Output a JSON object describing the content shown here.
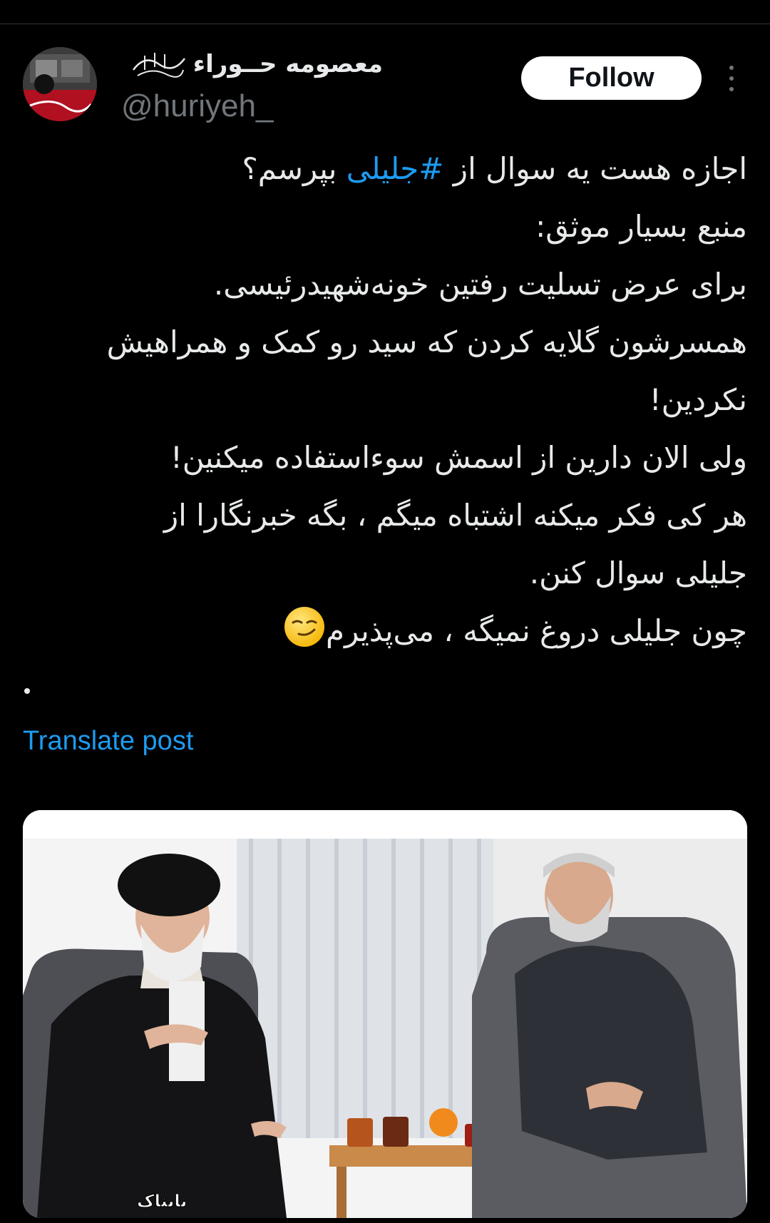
{
  "author": {
    "display_name": "معصومه حــوراء",
    "handle": "@huriyeh_",
    "avatar_icon": "profile-avatar"
  },
  "actions": {
    "follow_label": "Follow",
    "more_icon": "more-vertical-icon"
  },
  "tweet": {
    "lines": [
      {
        "before": "اجازه هست یه سوال از ",
        "hashtag": "#جلیلی",
        "after": " بپرسم؟"
      },
      {
        "text": "منبع بسیار موثق:"
      },
      {
        "text": "برای عرض تسلیت رفتین خونه‌شهیدرئیسی."
      },
      {
        "text": "همسرشون گلایه کردن که سید رو کمک و همراهیش"
      },
      {
        "text": "نکردین!"
      },
      {
        "text": "ولی الان دارین از اسمش سوءاستفاده میکنین!"
      },
      {
        "text": "هر کی فکر میکنه اشتباه میگم ، بگه خبرنگارا از"
      },
      {
        "text": "جلیلی سوال کنن."
      },
      {
        "text": "چون جلیلی دروغ نمیگه ، می‌پذیرم",
        "emoji": "smirk-face-emoji"
      }
    ],
    "bullet": "•",
    "translate_label": "Translate post"
  },
  "media": {
    "watermark": "تابناک"
  },
  "colors": {
    "background": "#000000",
    "text": "#e7e9ea",
    "secondary": "#71767b",
    "link": "#1d9bf0",
    "button_bg": "#ffffff",
    "button_text": "#0f1419"
  }
}
